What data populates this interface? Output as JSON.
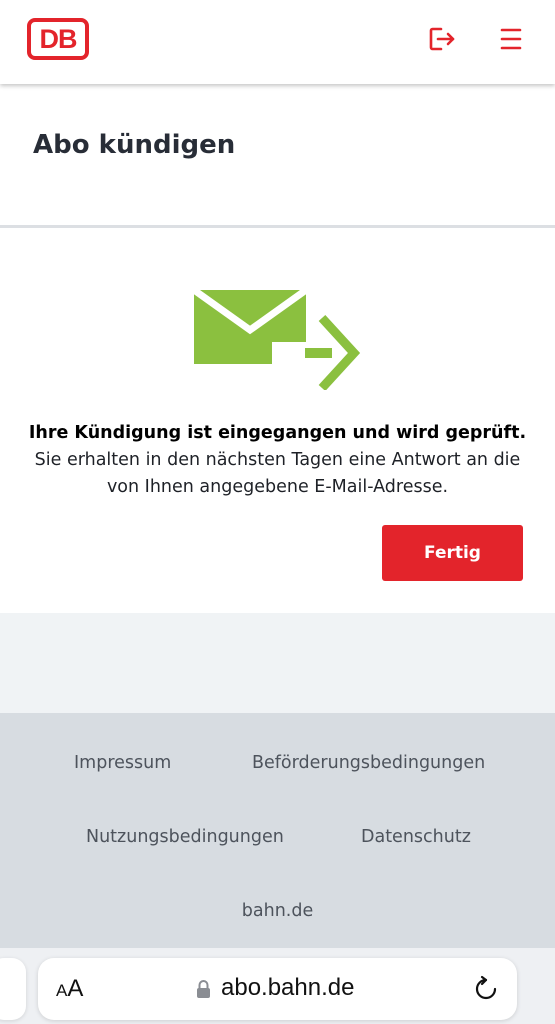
{
  "header": {
    "logo_text": "DB",
    "logout_icon": "logout-icon",
    "menu_icon": "hamburger-menu-icon",
    "accent_color": "#e3242b"
  },
  "page": {
    "title": "Abo kündigen"
  },
  "confirmation": {
    "icon": "email-sent-icon",
    "icon_color": "#8bc03f",
    "heading": "Ihre Kündigung ist eingegangen und wird geprüft.",
    "body_line1": "Sie erhalten in den nächsten Tagen eine Antwort an die",
    "body_line2": "von Ihnen angegebene E-Mail-Adresse.",
    "done_button": "Fertig"
  },
  "footer": {
    "links": [
      "Impressum",
      "Beförderungsbedingungen",
      "Nutzungsbedingungen",
      "Datenschutz",
      "bahn.de"
    ]
  },
  "browser": {
    "text_size_small": "A",
    "text_size_big": "A",
    "url": "abo.bahn.de",
    "lock_icon": "lock-icon",
    "reload_icon": "reload-icon"
  }
}
